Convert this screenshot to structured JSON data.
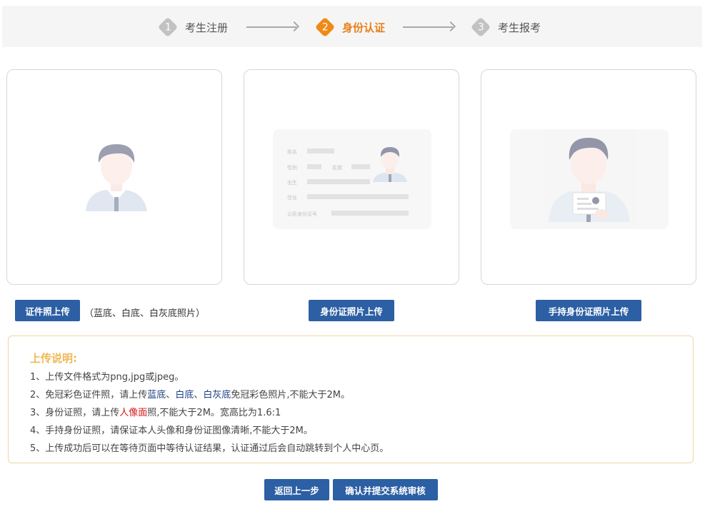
{
  "steps": [
    {
      "num": "1",
      "label": "考生注册"
    },
    {
      "num": "2",
      "label": "身份认证"
    },
    {
      "num": "3",
      "label": "考生报考"
    }
  ],
  "id_card_sample": {
    "name": "姓名",
    "gender": "性别",
    "ethnicity": "民族",
    "birth": "出生",
    "address": "住址",
    "id_number": "公民身份证号"
  },
  "uploads": {
    "photo_button": "证件照上传",
    "photo_note": "（蓝底、白底、白灰底照片）",
    "idcard_button": "身份证照片上传",
    "handheld_button": "手持身份证照片上传"
  },
  "instructions": {
    "title": "上传说明:",
    "line1": "1、上传文件格式为png,jpg或jpeg。",
    "line2_a": "2、免冠彩色证件照，请上传",
    "line2_b": "蓝底",
    "line2_c": "、",
    "line2_d": "白底",
    "line2_e": "、",
    "line2_f": "白灰底",
    "line2_g": "免冠彩色照片,不能大于2M。",
    "line3_a": "3、身份证照，请上传",
    "line3_b": "人像面",
    "line3_c": "照,不能大于2M。宽高比为1.6:1",
    "line4": "4、手持身份证照，请保证本人头像和身份证图像清晰,不能大于2M。",
    "line5": "5、上传成功后可以在等待页面中等待认证结果，认证通过后会自动跳转到个人中心页。"
  },
  "actions": {
    "back": "返回上一步",
    "submit": "确认并提交系统审核"
  },
  "colors": {
    "accent": "#ef8a17",
    "button": "#2c5fa3",
    "info_title": "#f0b858",
    "highlight_red": "#d11919"
  }
}
